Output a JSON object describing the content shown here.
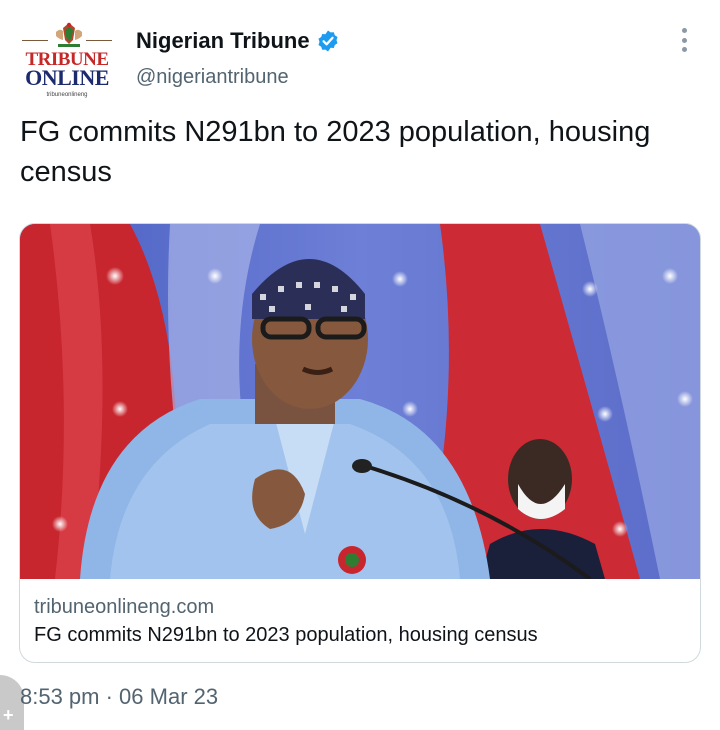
{
  "account": {
    "logo_line1": "TRIBUNE",
    "logo_line2": "ONLINE",
    "logo_url": "tribuneonlineng",
    "display_name": "Nigerian Tribune",
    "handle": "@nigeriantribune"
  },
  "tweet": {
    "text": "FG commits N291bn to 2023 population, housing census",
    "timestamp": "8:53 pm · 06 Mar 23"
  },
  "link_card": {
    "domain": "tribuneonlineng.com",
    "title": "FG commits N291bn to 2023 population, housing census"
  },
  "icons": {
    "verified": "verified-badge-icon",
    "more": "more-options-icon",
    "plus": "plus-icon"
  },
  "colors": {
    "verified_blue": "#1d9bf0",
    "secondary_text": "#536471",
    "logo_red": "#c62828",
    "logo_navy": "#1c2b6e"
  }
}
